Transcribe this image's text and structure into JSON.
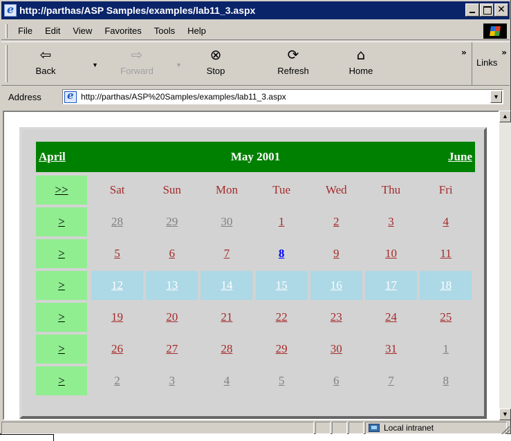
{
  "window": {
    "title": "http://parthas/ASP Samples/examples/lab11_3.aspx"
  },
  "menu": [
    {
      "label": "File",
      "name": "menu-file"
    },
    {
      "label": "Edit",
      "name": "menu-edit"
    },
    {
      "label": "View",
      "name": "menu-view"
    },
    {
      "label": "Favorites",
      "name": "menu-favorites"
    },
    {
      "label": "Tools",
      "name": "menu-tools"
    },
    {
      "label": "Help",
      "name": "menu-help"
    }
  ],
  "toolbar": {
    "back": "Back",
    "forward": "Forward",
    "stop": "Stop",
    "refresh": "Refresh",
    "home": "Home",
    "links": "Links",
    "icons": {
      "back": "back-arrow-icon",
      "forward": "forward-arrow-icon",
      "stop": "stop-icon",
      "refresh": "refresh-icon",
      "home": "home-icon"
    }
  },
  "address": {
    "label": "Address",
    "url": "http://parthas/ASP%20Samples/examples/lab11_3.aspx"
  },
  "calendar": {
    "prev": "April",
    "month": "May 2001",
    "next": "June",
    "month_selector": ">>",
    "week_selector": ">",
    "day_names": [
      "Sat",
      "Sun",
      "Mon",
      "Tue",
      "Wed",
      "Thu",
      "Fri"
    ],
    "weeks": [
      [
        {
          "d": "28",
          "other": true
        },
        {
          "d": "29",
          "other": true
        },
        {
          "d": "30",
          "other": true
        },
        {
          "d": "1"
        },
        {
          "d": "2"
        },
        {
          "d": "3"
        },
        {
          "d": "4"
        }
      ],
      [
        {
          "d": "5"
        },
        {
          "d": "6"
        },
        {
          "d": "7"
        },
        {
          "d": "8",
          "today": true
        },
        {
          "d": "9"
        },
        {
          "d": "10"
        },
        {
          "d": "11"
        }
      ],
      [
        {
          "d": "12"
        },
        {
          "d": "13"
        },
        {
          "d": "14"
        },
        {
          "d": "15"
        },
        {
          "d": "16"
        },
        {
          "d": "17"
        },
        {
          "d": "18"
        }
      ],
      [
        {
          "d": "19"
        },
        {
          "d": "20"
        },
        {
          "d": "21"
        },
        {
          "d": "22"
        },
        {
          "d": "23"
        },
        {
          "d": "24"
        },
        {
          "d": "25"
        }
      ],
      [
        {
          "d": "26"
        },
        {
          "d": "27"
        },
        {
          "d": "28"
        },
        {
          "d": "29"
        },
        {
          "d": "30"
        },
        {
          "d": "31"
        },
        {
          "d": "1",
          "other": true
        }
      ],
      [
        {
          "d": "2",
          "other": true
        },
        {
          "d": "3",
          "other": true
        },
        {
          "d": "4",
          "other": true
        },
        {
          "d": "5",
          "other": true
        },
        {
          "d": "6",
          "other": true
        },
        {
          "d": "7",
          "other": true
        },
        {
          "d": "8",
          "other": true
        }
      ]
    ],
    "selected_week": 2,
    "colors": {
      "title_bg": "#008000",
      "selector_bg": "#90ee90",
      "selected_bg": "#add8e6",
      "day_text": "#a52a2a",
      "other_month_text": "#808080",
      "today_text": "#0000ff",
      "frame": "#999999",
      "background": "#d3d3d3"
    }
  },
  "status": {
    "zone": "Local intranet"
  }
}
